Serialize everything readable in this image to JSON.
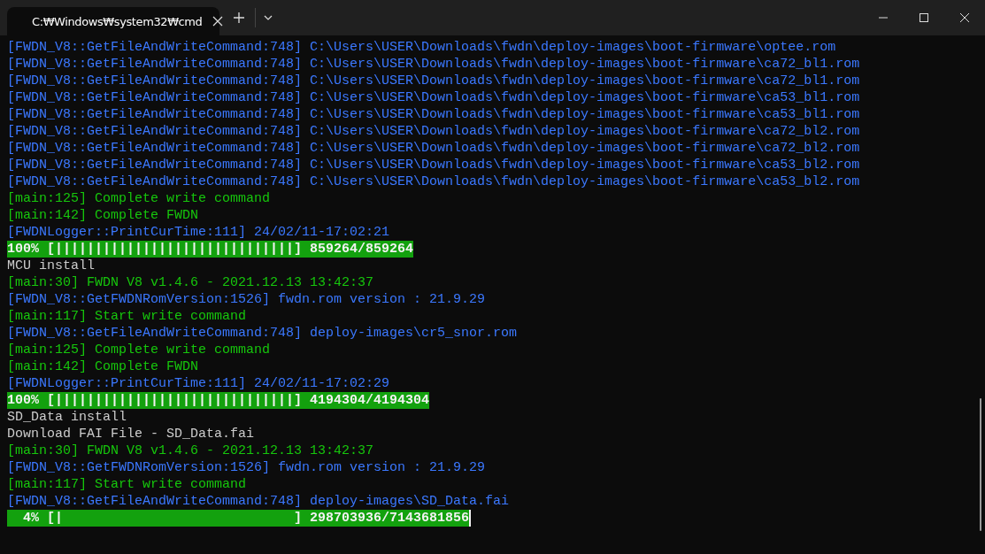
{
  "tab": {
    "title": "C:₩Windows₩system32₩cmd",
    "selected": true
  },
  "lines": [
    {
      "kind": "log",
      "text": "[FWDN_V8::GetFileAndWriteCommand:748] C:\\Users\\USER\\Downloads\\fwdn\\deploy-images\\boot-firmware\\optee.rom"
    },
    {
      "kind": "log",
      "text": "[FWDN_V8::GetFileAndWriteCommand:748] C:\\Users\\USER\\Downloads\\fwdn\\deploy-images\\boot-firmware\\ca72_bl1.rom"
    },
    {
      "kind": "log",
      "text": "[FWDN_V8::GetFileAndWriteCommand:748] C:\\Users\\USER\\Downloads\\fwdn\\deploy-images\\boot-firmware\\ca72_bl1.rom"
    },
    {
      "kind": "log",
      "text": "[FWDN_V8::GetFileAndWriteCommand:748] C:\\Users\\USER\\Downloads\\fwdn\\deploy-images\\boot-firmware\\ca53_bl1.rom"
    },
    {
      "kind": "log",
      "text": "[FWDN_V8::GetFileAndWriteCommand:748] C:\\Users\\USER\\Downloads\\fwdn\\deploy-images\\boot-firmware\\ca53_bl1.rom"
    },
    {
      "kind": "log",
      "text": "[FWDN_V8::GetFileAndWriteCommand:748] C:\\Users\\USER\\Downloads\\fwdn\\deploy-images\\boot-firmware\\ca72_bl2.rom"
    },
    {
      "kind": "log",
      "text": "[FWDN_V8::GetFileAndWriteCommand:748] C:\\Users\\USER\\Downloads\\fwdn\\deploy-images\\boot-firmware\\ca72_bl2.rom"
    },
    {
      "kind": "log",
      "text": "[FWDN_V8::GetFileAndWriteCommand:748] C:\\Users\\USER\\Downloads\\fwdn\\deploy-images\\boot-firmware\\ca53_bl2.rom"
    },
    {
      "kind": "log",
      "text": "[FWDN_V8::GetFileAndWriteCommand:748] C:\\Users\\USER\\Downloads\\fwdn\\deploy-images\\boot-firmware\\ca53_bl2.rom"
    },
    {
      "kind": "info",
      "text": "[main:125] Complete write command"
    },
    {
      "kind": "info",
      "text": "[main:142] Complete FWDN"
    },
    {
      "kind": "log",
      "text": "[FWDNLogger::PrintCurTime:111] 24/02/11-17:02:21"
    },
    {
      "kind": "progress",
      "text": "100% [||||||||||||||||||||||||||||||] 859264/859264"
    },
    {
      "kind": "plain",
      "text": "MCU install"
    },
    {
      "kind": "info",
      "text": "[main:30] FWDN V8 v1.4.6 - 2021.12.13 13:42:37"
    },
    {
      "kind": "log",
      "text": "[FWDN_V8::GetFWDNRomVersion:1526] fwdn.rom version : 21.9.29"
    },
    {
      "kind": "info",
      "text": "[main:117] Start write command"
    },
    {
      "kind": "log",
      "text": "[FWDN_V8::GetFileAndWriteCommand:748] deploy-images\\cr5_snor.rom"
    },
    {
      "kind": "info",
      "text": "[main:125] Complete write command"
    },
    {
      "kind": "info",
      "text": "[main:142] Complete FWDN"
    },
    {
      "kind": "log",
      "text": "[FWDNLogger::PrintCurTime:111] 24/02/11-17:02:29"
    },
    {
      "kind": "progress",
      "text": "100% [||||||||||||||||||||||||||||||] 4194304/4194304"
    },
    {
      "kind": "plain",
      "text": "SD_Data install"
    },
    {
      "kind": "plain",
      "text": "Download FAI File - SD_Data.fai"
    },
    {
      "kind": "info",
      "text": "[main:30] FWDN V8 v1.4.6 - 2021.12.13 13:42:37"
    },
    {
      "kind": "log",
      "text": "[FWDN_V8::GetFWDNRomVersion:1526] fwdn.rom version : 21.9.29"
    },
    {
      "kind": "info",
      "text": "[main:117] Start write command"
    },
    {
      "kind": "log",
      "text": "[FWDN_V8::GetFileAndWriteCommand:748] deploy-images\\SD_Data.fai"
    },
    {
      "kind": "progress",
      "text": "  4% [|                             ] 298703936/7143681856"
    }
  ]
}
